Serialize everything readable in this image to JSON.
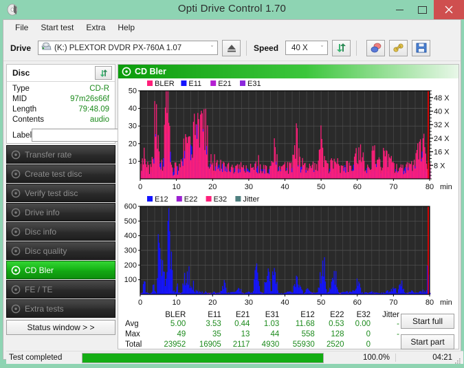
{
  "window": {
    "title": "Opti Drive Control 1.70",
    "icon": "disc-icon",
    "minimize": "–",
    "maximize": "□",
    "close": "×"
  },
  "menu": {
    "items": [
      {
        "label": "File",
        "name": "menu-file"
      },
      {
        "label": "Start test",
        "name": "menu-start-test"
      },
      {
        "label": "Extra",
        "name": "menu-extra"
      },
      {
        "label": "Help",
        "name": "menu-help"
      }
    ]
  },
  "toolbar": {
    "drive_label": "Drive",
    "drive_value": "(K:)   PLEXTOR DVDR   PX-760A 1.07",
    "drive_letter": "(K:)",
    "drive_name": "PLEXTOR DVDR   PX-760A 1.07",
    "speed_label": "Speed",
    "speed_value": "40 X",
    "combo_arrow": "ˇ",
    "eject_icon": "eject-icon",
    "refresh_icon": "refresh-icon",
    "erase_icon": "eraser-icon",
    "tools_icon": "tools-icon",
    "save_icon": "save-icon"
  },
  "disc": {
    "header": "Disc",
    "refresh_icon": "refresh-icon",
    "rows": [
      {
        "key": "Type",
        "value": "CD-R"
      },
      {
        "key": "MID",
        "value": "97m26s66f"
      },
      {
        "key": "Length",
        "value": "79:48.09"
      },
      {
        "key": "Contents",
        "value": "audio"
      }
    ],
    "label_key": "Label",
    "label_value": "",
    "label_placeholder": "",
    "label_button_icon": "cd-icon"
  },
  "sidebar": {
    "items": [
      {
        "label": "Transfer rate",
        "name": "sidebar-item-transfer-rate",
        "active": false
      },
      {
        "label": "Create test disc",
        "name": "sidebar-item-create-test-disc",
        "active": false
      },
      {
        "label": "Verify test disc",
        "name": "sidebar-item-verify-test-disc",
        "active": false
      },
      {
        "label": "Drive info",
        "name": "sidebar-item-drive-info",
        "active": false
      },
      {
        "label": "Disc info",
        "name": "sidebar-item-disc-info",
        "active": false
      },
      {
        "label": "Disc quality",
        "name": "sidebar-item-disc-quality",
        "active": false
      },
      {
        "label": "CD Bler",
        "name": "sidebar-item-cd-bler",
        "active": true
      },
      {
        "label": "FE / TE",
        "name": "sidebar-item-fe-te",
        "active": false
      },
      {
        "label": "Extra tests",
        "name": "sidebar-item-extra-tests",
        "active": false
      }
    ],
    "status_window_label": "Status window > >"
  },
  "panel": {
    "title": "CD Bler",
    "icon": "disc-icon"
  },
  "actions": {
    "start_full": "Start full",
    "start_part": "Start part"
  },
  "statusbar": {
    "message": "Test completed",
    "progress_percent": "100.0%",
    "progress_value": 100,
    "elapsed": "04:21"
  },
  "stats": {
    "columns": [
      "BLER",
      "E11",
      "E21",
      "E31",
      "E12",
      "E22",
      "E32",
      "Jitter"
    ],
    "rows": [
      {
        "label": "Avg",
        "values": [
          "5.00",
          "3.53",
          "0.44",
          "1.03",
          "11.68",
          "0.53",
          "0.00",
          "-"
        ]
      },
      {
        "label": "Max",
        "values": [
          "49",
          "35",
          "13",
          "44",
          "558",
          "128",
          "0",
          "-"
        ]
      },
      {
        "label": "Total",
        "values": [
          "23952",
          "16905",
          "2117",
          "4930",
          "55930",
          "2520",
          "0",
          ""
        ]
      }
    ]
  },
  "chart_data": [
    {
      "type": "area",
      "id": "bler-chart",
      "title": "",
      "xlabel": "min",
      "ylabel": "",
      "xlim": [
        0,
        80
      ],
      "ylim": [
        0,
        50
      ],
      "xticks": [
        0,
        10,
        20,
        30,
        40,
        50,
        60,
        70,
        80
      ],
      "yticks": [
        10,
        20,
        30,
        40,
        50
      ],
      "y2ticks": [
        "8 X",
        "16 X",
        "24 X",
        "32 X",
        "40 X",
        "48 X"
      ],
      "y2lim": [
        0,
        52
      ],
      "grid": true,
      "legend_position": "top-left",
      "background": "#2a2a2a",
      "legend": [
        {
          "name": "BLER",
          "color": "#ff1f7a"
        },
        {
          "name": "E11",
          "color": "#1414ff"
        },
        {
          "name": "E21",
          "color": "#b41fd2"
        },
        {
          "name": "E31",
          "color": "#8c28dc"
        }
      ],
      "speed_line_color": "#ff0000",
      "series": [
        {
          "name": "BLER",
          "color": "#ff1f7a",
          "x": [
            0,
            0.5,
            1,
            1.5,
            2,
            2.5,
            3,
            3.5,
            4,
            4.5,
            5,
            5.5,
            6,
            6.5,
            7,
            7.5,
            8,
            8.5,
            9,
            9.5,
            10,
            10.5,
            11,
            11.5,
            12,
            12.5,
            13,
            13.5,
            14,
            14.5,
            15,
            15.5,
            16,
            16.5,
            17,
            17.5,
            18,
            18.5,
            19,
            19.5,
            20,
            21,
            22,
            23,
            24,
            25,
            26,
            27,
            28,
            29,
            30,
            31,
            32,
            33,
            34,
            35,
            36,
            37,
            38,
            39,
            40,
            41,
            42,
            43,
            44,
            45,
            46,
            47,
            48,
            49,
            50,
            51,
            52,
            53,
            54,
            55,
            56,
            57,
            58,
            59,
            60,
            61,
            62,
            63,
            64,
            65,
            66,
            67,
            68,
            69,
            70,
            71,
            72,
            73,
            74,
            75,
            76,
            77,
            78,
            79,
            80
          ],
          "values": [
            9,
            11,
            19,
            8,
            7,
            6,
            9,
            10,
            44,
            33,
            20,
            14,
            8,
            26,
            49,
            42,
            37,
            10,
            5,
            10,
            6,
            9,
            8,
            12,
            19,
            22,
            17,
            30,
            24,
            35,
            27,
            40,
            34,
            31,
            44,
            48,
            33,
            27,
            12,
            10,
            9,
            12,
            10,
            9,
            8,
            7,
            9,
            8,
            7,
            9,
            7,
            8,
            9,
            10,
            8,
            7,
            9,
            24,
            8,
            7,
            9,
            8,
            10,
            32,
            12,
            9,
            8,
            7,
            9,
            8,
            24,
            9,
            8,
            13,
            10,
            8,
            7,
            9,
            8,
            10,
            18,
            17,
            9,
            8,
            16,
            15,
            10,
            16,
            14,
            12,
            9,
            8,
            7,
            9,
            10,
            8,
            12,
            24,
            22,
            10,
            9
          ]
        },
        {
          "name": "E11",
          "color": "#1414ff",
          "x": [
            0,
            0.5,
            1,
            1.5,
            2,
            2.5,
            3,
            3.5,
            4,
            4.5,
            5,
            5.5,
            6,
            6.5,
            7,
            7.5,
            8,
            8.5,
            9,
            9.5,
            10,
            10.5,
            11,
            11.5,
            12,
            12.5,
            13,
            13.5,
            14,
            14.5,
            15,
            15.5,
            16,
            16.5,
            17,
            17.5,
            18,
            18.5,
            19,
            19.5,
            20,
            21,
            22,
            23,
            24,
            25,
            26,
            27,
            28,
            29,
            30,
            31,
            32,
            33,
            34,
            35,
            36,
            37,
            38,
            39,
            40,
            41,
            42,
            43,
            44,
            45,
            46,
            47,
            48,
            49,
            50,
            51,
            52,
            53,
            54,
            55,
            56,
            57,
            58,
            59,
            60,
            61,
            62,
            63,
            64,
            65,
            66,
            67,
            68,
            69,
            70,
            71,
            72,
            73,
            74,
            75,
            76,
            77,
            78,
            79,
            80
          ],
          "values": [
            7,
            8,
            11,
            6,
            5,
            4,
            6,
            7,
            26,
            18,
            12,
            9,
            5,
            17,
            31,
            27,
            22,
            7,
            4,
            7,
            4,
            6,
            6,
            9,
            13,
            15,
            12,
            20,
            17,
            24,
            19,
            27,
            24,
            22,
            27,
            27,
            20,
            18,
            8,
            7,
            6,
            8,
            7,
            6,
            5,
            5,
            6,
            5,
            5,
            6,
            5,
            6,
            6,
            7,
            6,
            5,
            6,
            9,
            6,
            5,
            6,
            6,
            7,
            9,
            8,
            6,
            5,
            5,
            6,
            6,
            8,
            6,
            5,
            9,
            7,
            5,
            5,
            6,
            5,
            7,
            9,
            8,
            6,
            5,
            10,
            9,
            7,
            9,
            9,
            8,
            6,
            5,
            5,
            6,
            7,
            6,
            8,
            14,
            13,
            7,
            6
          ]
        },
        {
          "name": "E21",
          "color": "#b41fd2",
          "x": [
            0,
            5,
            6,
            7,
            8,
            9,
            13,
            14,
            15,
            16,
            17,
            18,
            19,
            20,
            43,
            51,
            62,
            79,
            80
          ],
          "values": [
            1,
            3,
            4,
            6,
            5,
            2,
            3,
            4,
            5,
            6,
            7,
            6,
            4,
            2,
            3,
            3,
            3,
            4,
            3
          ]
        },
        {
          "name": "E31",
          "color": "#8c28dc",
          "x": [
            0,
            6,
            7,
            8,
            14,
            16,
            18,
            19,
            80
          ],
          "values": [
            1,
            2,
            3,
            2,
            2,
            3,
            3,
            2,
            2
          ]
        }
      ]
    },
    {
      "type": "area",
      "id": "e12-chart",
      "title": "",
      "xlabel": "min",
      "ylabel": "",
      "xlim": [
        0,
        80
      ],
      "ylim": [
        0,
        600
      ],
      "xticks": [
        0,
        10,
        20,
        30,
        40,
        50,
        60,
        70,
        80
      ],
      "yticks": [
        100,
        200,
        300,
        400,
        500,
        600
      ],
      "grid": true,
      "legend_position": "top-left",
      "background": "#2a2a2a",
      "legend": [
        {
          "name": "E12",
          "color": "#1414ff"
        },
        {
          "name": "E22",
          "color": "#9b1fd2"
        },
        {
          "name": "E32",
          "color": "#ff1f7a"
        },
        {
          "name": "Jitter",
          "color": "#4f8080"
        }
      ],
      "speed_line_color": "#ff0000",
      "series": [
        {
          "name": "E12",
          "color": "#1414ff",
          "x": [
            0,
            0.5,
            1,
            1.5,
            2,
            2.5,
            3,
            3.5,
            4,
            4.5,
            5,
            5.5,
            6,
            6.5,
            7,
            7.5,
            8,
            8.5,
            9,
            9.5,
            10,
            10.5,
            11,
            11.5,
            12,
            12.5,
            13,
            13.5,
            14,
            14.5,
            15,
            15.5,
            16,
            16.5,
            17,
            17.5,
            18,
            18.5,
            19,
            19.5,
            20,
            21,
            22,
            23,
            24,
            25,
            26,
            27,
            28,
            29,
            30,
            31,
            32,
            33,
            34,
            35,
            36,
            37,
            38,
            39,
            40,
            41,
            42,
            43,
            43.5,
            44,
            44.5,
            45,
            46,
            47,
            48,
            49,
            50,
            51,
            51.5,
            52,
            53,
            54,
            54.5,
            55,
            56,
            57,
            58,
            59,
            60,
            61,
            62,
            63,
            64,
            65,
            66,
            67,
            68,
            69,
            70,
            71,
            72,
            73,
            74,
            75,
            76,
            77,
            78,
            79,
            79.5,
            80
          ],
          "values": [
            5,
            10,
            180,
            15,
            8,
            5,
            10,
            70,
            15,
            20,
            480,
            300,
            240,
            150,
            100,
            430,
            555,
            300,
            35,
            20,
            100,
            20,
            10,
            15,
            190,
            30,
            210,
            120,
            30,
            100,
            20,
            25,
            30,
            15,
            20,
            10,
            15,
            8,
            10,
            5,
            20,
            10,
            15,
            90,
            10,
            20,
            15,
            90,
            10,
            15,
            20,
            10,
            250,
            15,
            20,
            245,
            20,
            210,
            15,
            10,
            20,
            15,
            25,
            135,
            140,
            60,
            30,
            15,
            40,
            20,
            10,
            15,
            250,
            230,
            20,
            15,
            100,
            155,
            20,
            10,
            15,
            20,
            15,
            30,
            130,
            20,
            15,
            10,
            20,
            15,
            10,
            15,
            20,
            40,
            45,
            15,
            100,
            10,
            15,
            20,
            10,
            15,
            30,
            20,
            250,
            20
          ]
        },
        {
          "name": "E22",
          "color": "#9b1fd2",
          "x": [
            5.5,
            6,
            7,
            7.5,
            8,
            8.5,
            9
          ],
          "values": [
            10,
            15,
            20,
            40,
            35,
            20,
            10
          ]
        },
        {
          "name": "E32",
          "color": "#ff1f7a",
          "x": [],
          "values": []
        },
        {
          "name": "Jitter",
          "color": "#4f8080",
          "x": [],
          "values": []
        }
      ]
    }
  ]
}
